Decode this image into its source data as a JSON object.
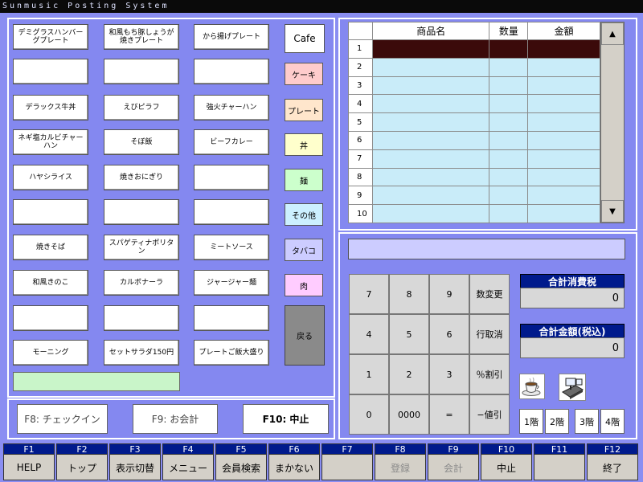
{
  "title": "Sunmusic Posting System",
  "menu_items": [
    [
      "デミグラスハンバーグプレート",
      "和風もち豚しょうが焼きプレート",
      "から揚げプレート"
    ],
    [
      "",
      "",
      ""
    ],
    [
      "デラックス牛丼",
      "えびピラフ",
      "強火チャーハン"
    ],
    [
      "ネギ塩カルビチャーハン",
      "そぼ飯",
      "ビーフカレー"
    ],
    [
      "ハヤシライス",
      "焼きおにぎり",
      ""
    ],
    [
      "",
      "",
      ""
    ],
    [
      "焼きそば",
      "スパゲティナポリタン",
      "ミートソース"
    ],
    [
      "和風きのこ",
      "カルボナーラ",
      "ジャージャー麺"
    ],
    [
      "",
      "",
      ""
    ],
    [
      "モーニング",
      "セットサラダ150円",
      "プレートご飯大盛り"
    ]
  ],
  "categories": [
    {
      "label": "Cafe",
      "color": "#ffffff"
    },
    {
      "label": "ケーキ",
      "color": "#ffcccc"
    },
    {
      "label": "プレート",
      "color": "#ffe6cc"
    },
    {
      "label": "丼",
      "color": "#ffffcc"
    },
    {
      "label": "麺",
      "color": "#ccffcc"
    },
    {
      "label": "その他",
      "color": "#ccf0ff"
    },
    {
      "label": "タバコ",
      "color": "#ccccff"
    },
    {
      "label": "肉",
      "color": "#ffccff"
    }
  ],
  "back_label": "戻る",
  "left_bottom": {
    "checkin": "F8: チェックイン",
    "checkout": "F9: お会計",
    "cancel": "F10: 中止"
  },
  "order_table": {
    "headers": [
      "商品名",
      "数量",
      "金額"
    ],
    "rows": [
      "1",
      "2",
      "3",
      "4",
      "5",
      "6",
      "7",
      "8",
      "9",
      "10"
    ],
    "selected_row": 1
  },
  "scroll": {
    "up": "▲",
    "down": "▼"
  },
  "keypad": [
    [
      "7",
      "8",
      "9",
      "数変更"
    ],
    [
      "4",
      "5",
      "6",
      "行取消"
    ],
    [
      "1",
      "2",
      "3",
      "％割引"
    ],
    [
      "0",
      "0000",
      "=",
      "−値引"
    ]
  ],
  "tax": {
    "label": "合計消費税",
    "value": "0"
  },
  "total": {
    "label": "合計金額(税込)",
    "value": "0"
  },
  "floors": [
    "1階",
    "2階",
    "3階",
    "4階"
  ],
  "fkeys": [
    {
      "num": "F1",
      "label": "HELP",
      "enabled": true
    },
    {
      "num": "F2",
      "label": "トップ",
      "enabled": true
    },
    {
      "num": "F3",
      "label": "表示切替",
      "enabled": true
    },
    {
      "num": "F4",
      "label": "メニュー",
      "enabled": true
    },
    {
      "num": "F5",
      "label": "会員検索",
      "enabled": true
    },
    {
      "num": "F6",
      "label": "まかない",
      "enabled": true
    },
    {
      "num": "F7",
      "label": "",
      "enabled": true
    },
    {
      "num": "F8",
      "label": "登録",
      "enabled": false
    },
    {
      "num": "F9",
      "label": "会計",
      "enabled": false
    },
    {
      "num": "F10",
      "label": "中止",
      "enabled": true
    },
    {
      "num": "F11",
      "label": "",
      "enabled": true
    },
    {
      "num": "F12",
      "label": "終了",
      "enabled": true
    }
  ]
}
